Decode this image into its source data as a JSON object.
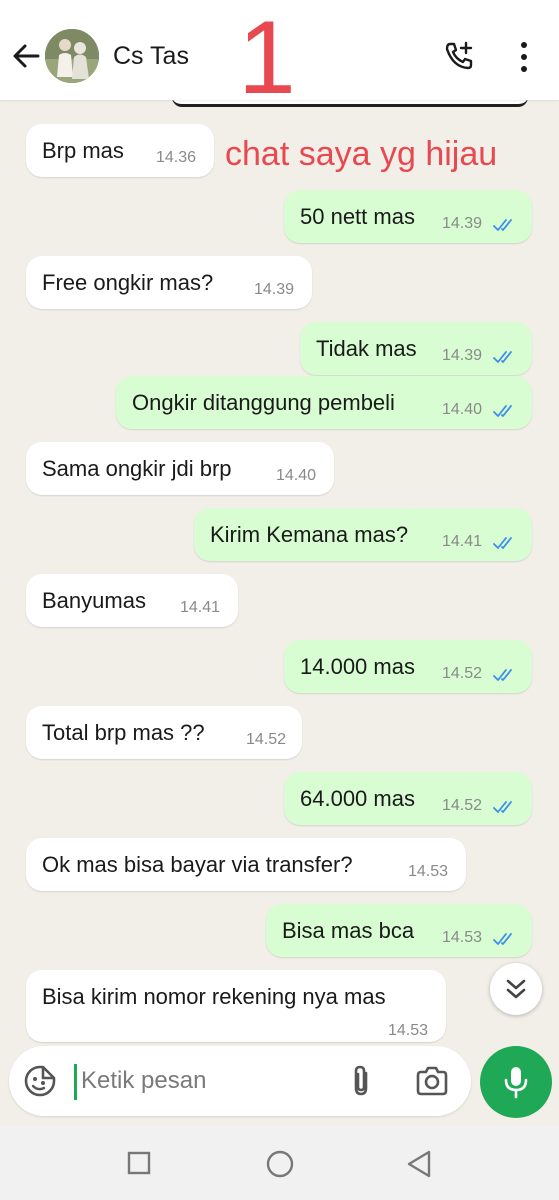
{
  "header": {
    "contact_name": "Cs Tas",
    "back_icon": "arrow-left-icon",
    "add_call_icon": "phone-plus-icon",
    "menu_icon": "more-vertical-icon"
  },
  "annotation": {
    "number": "1",
    "note": "chat saya yg hijau",
    "color": "#e8484f"
  },
  "messages": [
    {
      "dir": "in",
      "text": "Brp mas",
      "time": "14.36"
    },
    {
      "dir": "out",
      "text": "50 nett mas",
      "time": "14.39"
    },
    {
      "dir": "in",
      "text": "Free ongkir mas?",
      "time": "14.39"
    },
    {
      "dir": "out",
      "text": "Tidak mas",
      "time": "14.39"
    },
    {
      "dir": "out",
      "text": "Ongkir ditanggung pembeli",
      "time": "14.40"
    },
    {
      "dir": "in",
      "text": "Sama ongkir jdi brp",
      "time": "14.40"
    },
    {
      "dir": "out",
      "text": "Kirim Kemana mas?",
      "time": "14.41"
    },
    {
      "dir": "in",
      "text": "Banyumas",
      "time": "14.41"
    },
    {
      "dir": "out",
      "text": "14.000 mas",
      "time": "14.52"
    },
    {
      "dir": "in",
      "text": "Total brp mas ??",
      "time": "14.52"
    },
    {
      "dir": "out",
      "text": "64.000 mas",
      "time": "14.52"
    },
    {
      "dir": "in",
      "text": "Ok mas bisa bayar via transfer?",
      "time": "14.53"
    },
    {
      "dir": "out",
      "text": "Bisa mas bca",
      "time": "14.53"
    },
    {
      "dir": "in",
      "text": "Bisa kirim nomor rekening nya mas",
      "time": "14.53"
    }
  ],
  "composer": {
    "placeholder": "Ketik pesan",
    "sticker_icon": "sticker-icon",
    "attach_icon": "paperclip-icon",
    "camera_icon": "camera-icon",
    "mic_icon": "microphone-icon"
  },
  "scroll_down_icon": "double-chevron-down-icon",
  "colors": {
    "chat_background": "#f2efe9",
    "outgoing_bubble": "#d8fdd2",
    "incoming_bubble": "#ffffff",
    "accent_green": "#1fa855",
    "read_tick": "#3b8fe6"
  },
  "navbar": {
    "recent_icon": "square-icon",
    "home_icon": "circle-icon",
    "back_icon": "triangle-back-icon"
  }
}
